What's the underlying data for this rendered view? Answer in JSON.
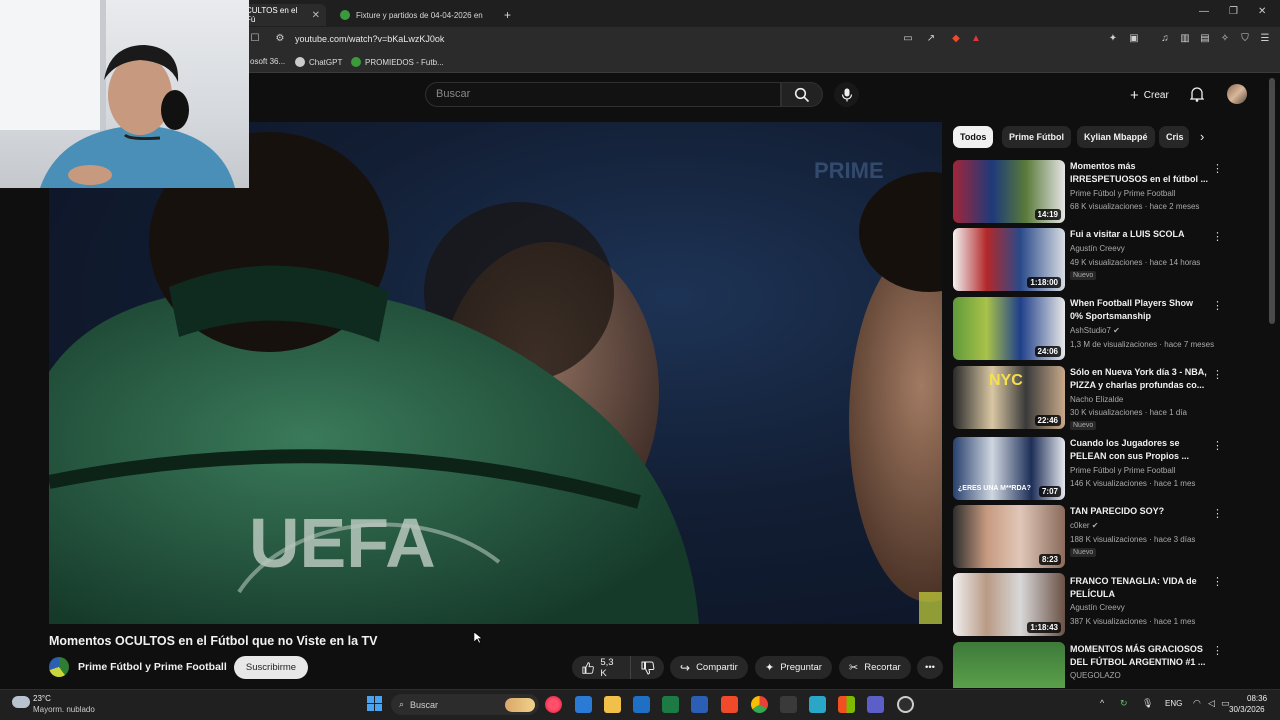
{
  "browser": {
    "tabs": [
      {
        "label": "CULTOS en el Fú",
        "active": true
      },
      {
        "label": "Fixture y partidos de 04-04-2026 en",
        "active": false
      }
    ],
    "new_tab_label": "+",
    "url": "youtube.com/watch?v=bKaLwzKJ0ok",
    "bookmarks": [
      "osoft 36...",
      "ChatGPT",
      "PROMIEDOS - Futb..."
    ]
  },
  "header": {
    "search_placeholder": "Buscar",
    "create_label": "Crear"
  },
  "video": {
    "title": "Momentos OCULTOS en el Fútbol que no Viste en la TV",
    "channel": "Prime Fútbol y Prime Football",
    "subscribe_label": "Suscribirme",
    "likes": "5,3 K",
    "share_label": "Compartir",
    "ask_label": "Preguntar",
    "clip_label": "Recortar",
    "watermark": "PRIME",
    "jacket_text": "UEFA"
  },
  "chips": [
    "Todos",
    "Prime Fútbol",
    "Kylian Mbappé",
    "Cris"
  ],
  "recommendations": [
    {
      "title": "Momentos más IRRESPETUOSOS en el fútbol ...",
      "channel": "Prime Fútbol y Prime Football",
      "meta": "68 K visualizaciones · hace 2 meses",
      "duration": "14:19",
      "badge": ""
    },
    {
      "title": "Fui a visitar a LUIS SCOLA",
      "channel": "Agustín Creevy",
      "meta": "49 K visualizaciones · hace 14 horas",
      "duration": "1:18:00",
      "badge": "Nuevo"
    },
    {
      "title": "When Football Players Show 0% Sportsmanship",
      "channel": "AshStudio7",
      "meta": "1,3 M de visualizaciones · hace 7 meses",
      "duration": "24:06",
      "badge": ""
    },
    {
      "title": "Sólo en Nueva York día 3 - NBA, PIZZA y charlas profundas co...",
      "channel": "Nacho Elizalde",
      "meta": "30 K visualizaciones · hace 1 día",
      "duration": "22:46",
      "badge": "Nuevo"
    },
    {
      "title": "Cuando los Jugadores se PELEAN con sus Propios ...",
      "channel": "Prime Fútbol y Prime Football",
      "meta": "146 K visualizaciones · hace 1 mes",
      "duration": "7:07",
      "badge": ""
    },
    {
      "title": "TAN PARECIDO SOY?",
      "channel": "c0ker",
      "meta": "188 K visualizaciones · hace 3 días",
      "duration": "8:23",
      "badge": "Nuevo"
    },
    {
      "title": "FRANCO TENAGLIA: VIDA de PELÍCULA",
      "channel": "Agustín Creevy",
      "meta": "387 K visualizaciones · hace 1 mes",
      "duration": "1:18:43",
      "badge": ""
    },
    {
      "title": "MOMENTOS MÁS GRACIOSOS DEL FÚTBOL ARGENTINO #1 ...",
      "channel": "QUEGOLAZO",
      "meta": "",
      "duration": "",
      "badge": ""
    }
  ],
  "thumb_captions": {
    "nyc": "NYC",
    "eres": "¿ERES UNA M**RDA?"
  },
  "taskbar": {
    "weather_temp": "23°C",
    "weather_desc": "Mayorm. nublado",
    "search_label": "Buscar",
    "lang": "ENG",
    "time": "08:36",
    "date": "30/3/2026"
  }
}
